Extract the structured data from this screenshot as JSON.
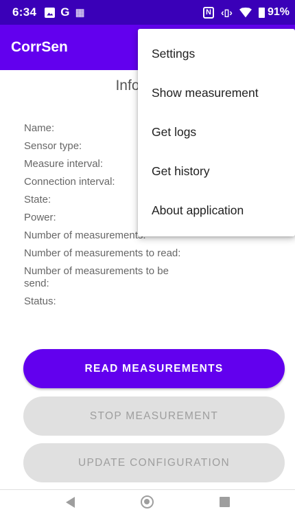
{
  "status_bar": {
    "time": "6:34",
    "left_icons": [
      "image-icon",
      "google-g-icon",
      "calendar-icon"
    ],
    "right_icons": [
      "nfc-icon",
      "vibrate-icon",
      "wifi-icon",
      "battery-icon"
    ],
    "g_glyph": "G",
    "nfc_glyph": "N",
    "battery": "91%"
  },
  "app_bar": {
    "title": "CorrSen"
  },
  "info": {
    "title": "Information",
    "rows": [
      "Name:",
      "Sensor type:",
      "Measure interval:",
      "Connection interval:",
      "State:",
      "Power:",
      "Number of measurements:",
      "Number of measurements to read:",
      "Number of measurements to be send:",
      "Status:"
    ]
  },
  "buttons": {
    "read": "READ MEASUREMENTS",
    "stop": "STOP MEASUREMENT",
    "update": "UPDATE CONFIGURATION"
  },
  "menu": {
    "items": [
      "Settings",
      "Show measurement",
      "Get logs",
      "Get history",
      "About application"
    ]
  },
  "colors": {
    "status_bar": "#3a00b8",
    "app_bar": "#6200ee",
    "primary_button": "#6200ee",
    "disabled_button": "#e0e0e0"
  }
}
